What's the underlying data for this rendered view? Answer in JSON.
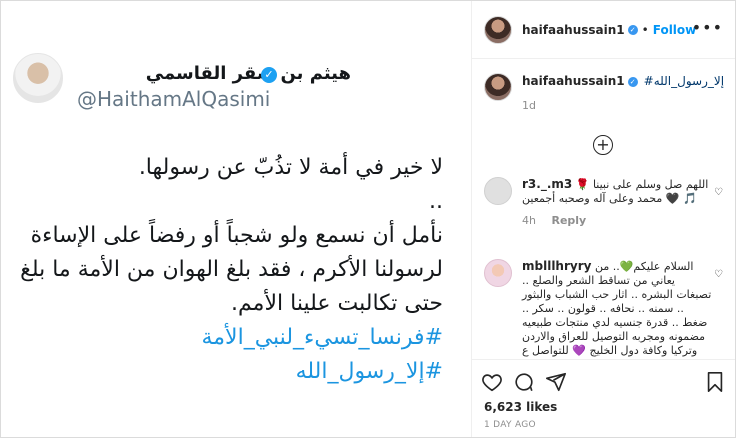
{
  "tweet": {
    "display_name": "هيثم بن صقر القاسمي",
    "handle": "@HaithamAlQasimi",
    "lines": [
      "لا خير في أمة لا تذُبّ عن رسولها.",
      "..",
      "نأمل أن نسمع ولو شجباً أو رفضاً على الإساءة",
      "لرسولنا الأكرم ، فقد بلغ الهوان من الأمة ما بلغ",
      "حتى تكالبت علينا الأمم."
    ],
    "hashtags": [
      "#فرنسا_تسيء_لنبي_الأمة",
      "#إلا_رسول_الله"
    ]
  },
  "header": {
    "username": "haifaahussain1",
    "follow_label": "Follow",
    "more_icon": "more-horizontal-icon"
  },
  "caption": {
    "username": "haifaahussain1",
    "hashtag": "#إلا_رسول_الله",
    "time": "1d"
  },
  "comments": [
    {
      "username": "r3._.m3",
      "text": "اللهم صل وسلم على نبينا 🌹 محمد وعلى آله وصحبه أجمعين 🖤 🎵",
      "time": "4h",
      "reply_label": "Reply"
    },
    {
      "username": "mblllhryry",
      "text": "السلام عليكم💚.. من يعاني من تساقط الشعر والصلع .. تصبغات البشره .. اثار حب الشباب والبثور .. سمنه .. نحافه .. قولون .. سكر .. ضغط .. قدرة جنسيه لدي منتجات طبيعيه مضمونه ومجربه التوصيل للعراق والاردن وتركيا وكافة دول الخليج 💜 للتواصل ع الخاص"
    }
  ],
  "actions": {
    "likes": "6,623 likes",
    "time_ago": "1 DAY AGO"
  },
  "colors": {
    "tweet_link": "#1b95e0",
    "follow": "#0095f6",
    "verified": "#3897f0"
  }
}
